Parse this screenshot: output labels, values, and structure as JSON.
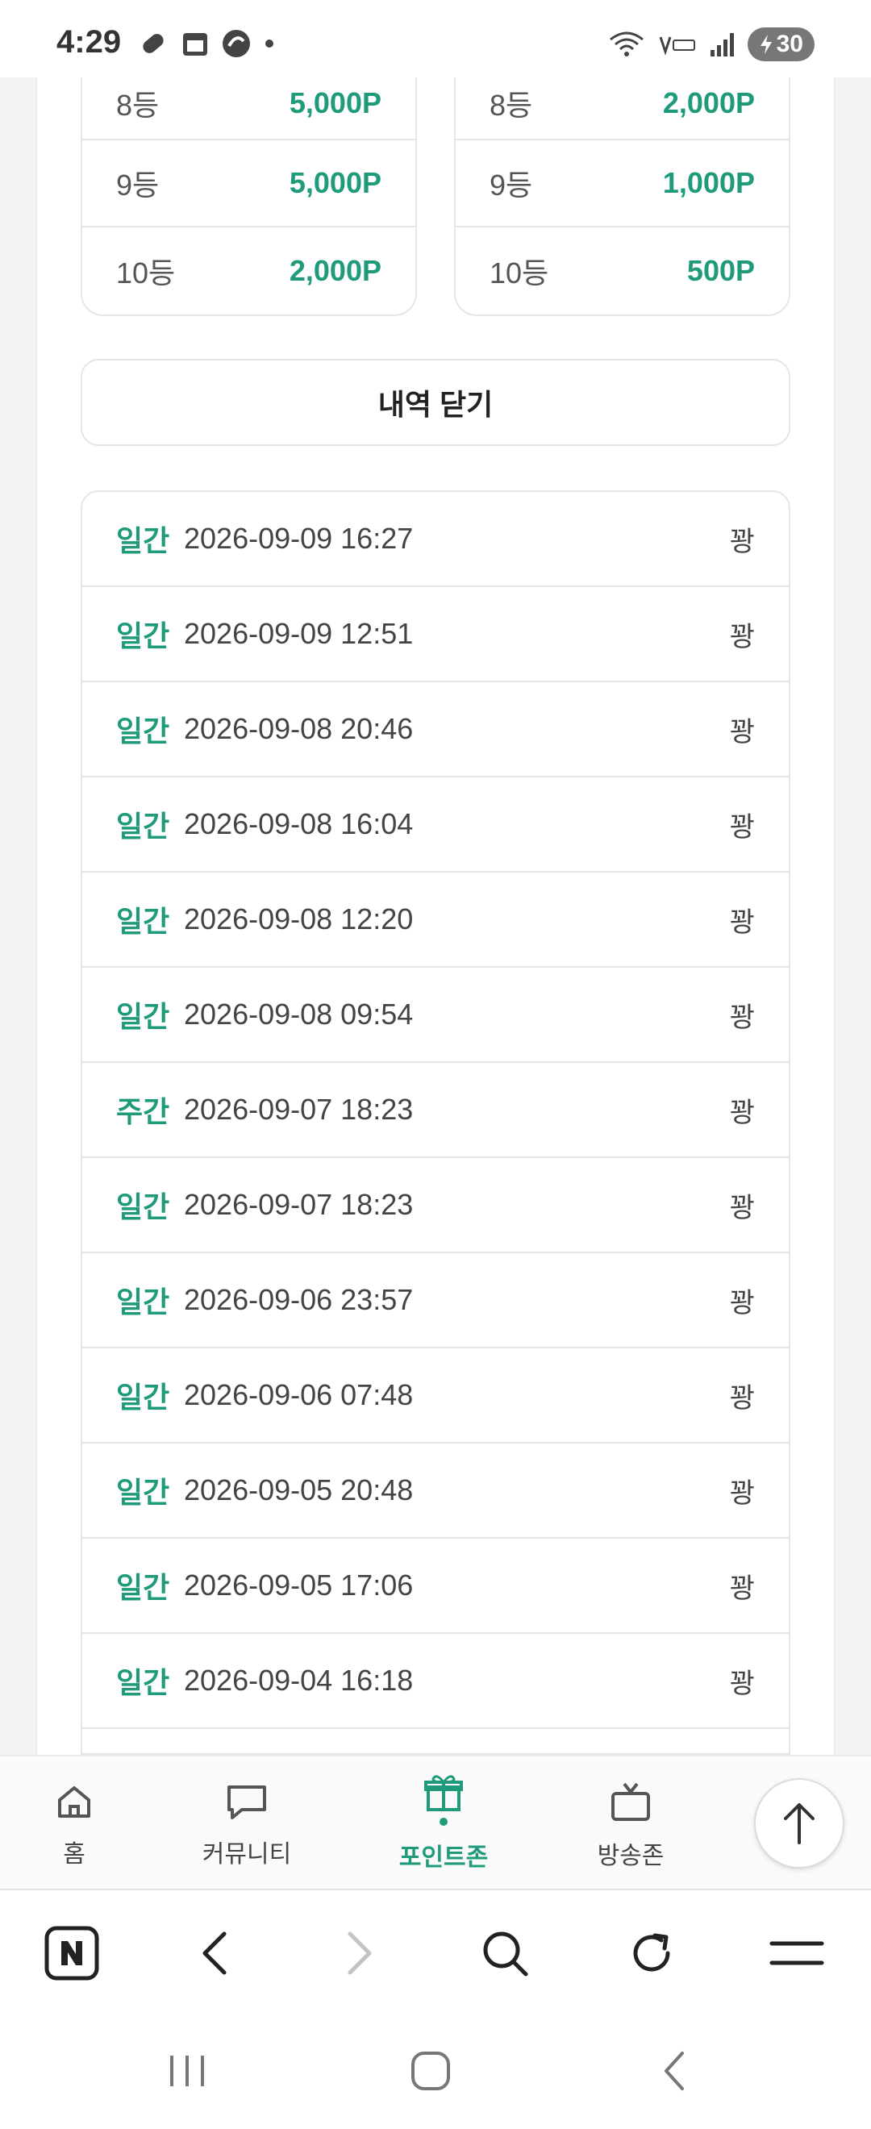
{
  "status_bar": {
    "time": "4:29",
    "battery": "30"
  },
  "rank_tables": [
    {
      "rows": [
        {
          "rank": "8등",
          "points": "5,000P"
        },
        {
          "rank": "9등",
          "points": "5,000P"
        },
        {
          "rank": "10등",
          "points": "2,000P"
        }
      ]
    },
    {
      "rows": [
        {
          "rank": "8등",
          "points": "2,000P"
        },
        {
          "rank": "9등",
          "points": "1,000P"
        },
        {
          "rank": "10등",
          "points": "500P"
        }
      ]
    }
  ],
  "close_button": "내역 닫기",
  "history": [
    {
      "type": "일간",
      "date": "2026-09-09 16:27",
      "result": "꽝"
    },
    {
      "type": "일간",
      "date": "2026-09-09 12:51",
      "result": "꽝"
    },
    {
      "type": "일간",
      "date": "2026-09-08 20:46",
      "result": "꽝"
    },
    {
      "type": "일간",
      "date": "2026-09-08 16:04",
      "result": "꽝"
    },
    {
      "type": "일간",
      "date": "2026-09-08 12:20",
      "result": "꽝"
    },
    {
      "type": "일간",
      "date": "2026-09-08 09:54",
      "result": "꽝"
    },
    {
      "type": "주간",
      "date": "2026-09-07 18:23",
      "result": "꽝"
    },
    {
      "type": "일간",
      "date": "2026-09-07 18:23",
      "result": "꽝"
    },
    {
      "type": "일간",
      "date": "2026-09-06 23:57",
      "result": "꽝"
    },
    {
      "type": "일간",
      "date": "2026-09-06 07:48",
      "result": "꽝"
    },
    {
      "type": "일간",
      "date": "2026-09-05 20:48",
      "result": "꽝"
    },
    {
      "type": "일간",
      "date": "2026-09-05 17:06",
      "result": "꽝"
    },
    {
      "type": "일간",
      "date": "2026-09-04 16:18",
      "result": "꽝"
    }
  ],
  "bottom_nav": {
    "home": "홈",
    "community": "커뮤니티",
    "point_zone": "포인트존",
    "broadcast_zone": "방송존"
  },
  "colors": {
    "accent": "#1f9a7a",
    "border": "#e3e6e8"
  }
}
